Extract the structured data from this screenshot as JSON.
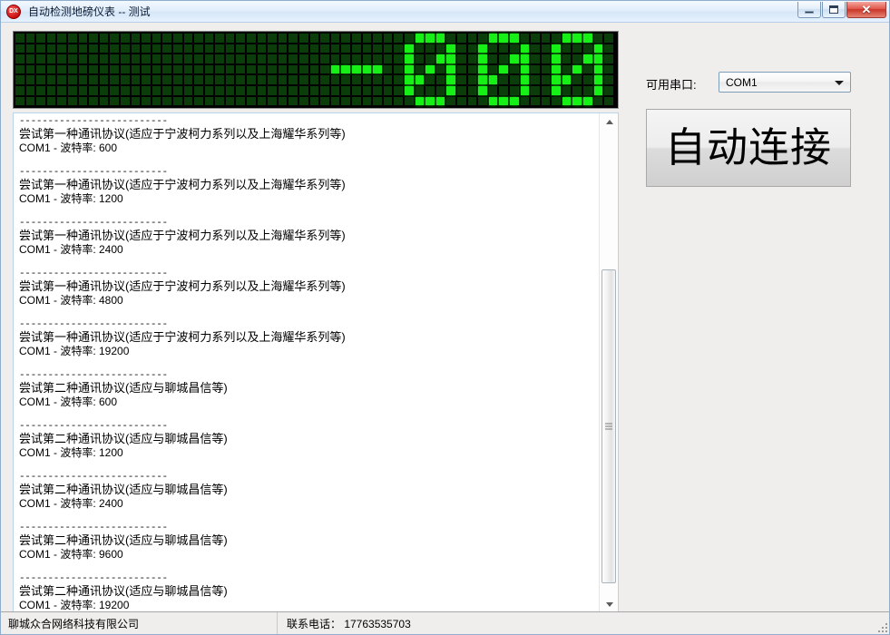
{
  "window": {
    "title": "自动检测地磅仪表 -- 测试",
    "icon": "app-icon-dx",
    "icon_text": "DX",
    "buttons": {
      "minimize": "minimize-icon",
      "maximize": "maximize-icon",
      "close": "✕"
    }
  },
  "led_display": {
    "value": "-000",
    "columns": 57,
    "rows": 7,
    "on_color": "#16f016",
    "off_color": "#0b3d0b",
    "background": "#000000",
    "glyph_start_column": 30
  },
  "log": {
    "entries": [
      {
        "separator": "--------------------------",
        "title": "尝试第一种通讯协议(适应于宁波柯力系列以及上海耀华系列等)",
        "detail": "COM1 - 波特率: 600"
      },
      {
        "separator": "--------------------------",
        "title": "尝试第一种通讯协议(适应于宁波柯力系列以及上海耀华系列等)",
        "detail": "COM1 - 波特率: 1200"
      },
      {
        "separator": "--------------------------",
        "title": "尝试第一种通讯协议(适应于宁波柯力系列以及上海耀华系列等)",
        "detail": "COM1 - 波特率: 2400"
      },
      {
        "separator": "--------------------------",
        "title": "尝试第一种通讯协议(适应于宁波柯力系列以及上海耀华系列等)",
        "detail": "COM1 - 波特率: 4800"
      },
      {
        "separator": "--------------------------",
        "title": "尝试第一种通讯协议(适应于宁波柯力系列以及上海耀华系列等)",
        "detail": "COM1 - 波特率: 19200"
      },
      {
        "separator": "--------------------------",
        "title": "尝试第二种通讯协议(适应与聊城昌信等)",
        "detail": "COM1 - 波特率: 600"
      },
      {
        "separator": "--------------------------",
        "title": "尝试第二种通讯协议(适应与聊城昌信等)",
        "detail": "COM1 - 波特率: 1200"
      },
      {
        "separator": "--------------------------",
        "title": "尝试第二种通讯协议(适应与聊城昌信等)",
        "detail": "COM1 - 波特率: 2400"
      },
      {
        "separator": "--------------------------",
        "title": "尝试第二种通讯协议(适应与聊城昌信等)",
        "detail": "COM1 - 波特率: 9600"
      },
      {
        "separator": "--------------------------",
        "title": "尝试第二种通讯协议(适应与聊城昌信等)",
        "detail": "COM1 - 波特率: 19200"
      }
    ],
    "scrollbar": {
      "up_arrow": "triangle-up-icon",
      "down_arrow": "triangle-down-icon",
      "thumb_grip": "grip-icon"
    }
  },
  "controls": {
    "com_label": "可用串口:",
    "com_selected": "COM1",
    "com_options": [
      "COM1"
    ],
    "com_dropdown_icon": "chevron-down-icon",
    "connect_button": "自动连接"
  },
  "statusbar": {
    "company": "聊城众合网络科技有限公司",
    "phone": "联系电话： 17763535703",
    "resize_grip": "resize-grip-icon"
  }
}
